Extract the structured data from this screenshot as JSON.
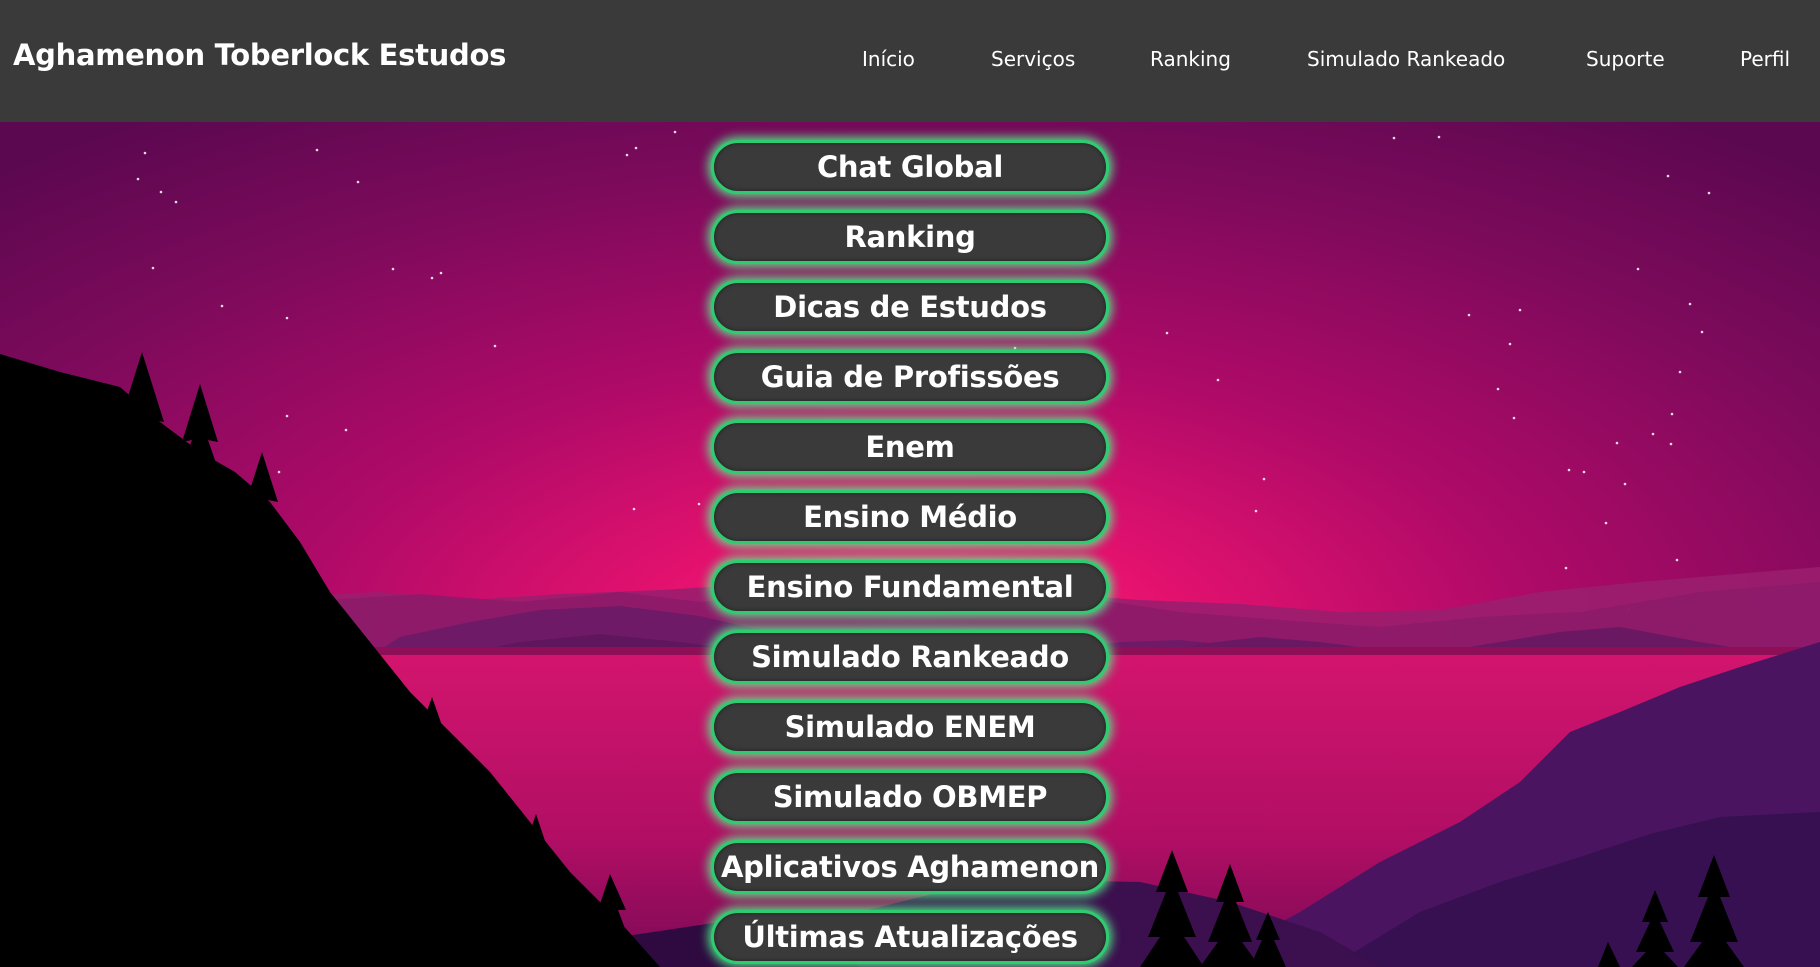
{
  "header": {
    "brand": "Aghamenon Toberlock Estudos",
    "nav": [
      "Início",
      "Serviços",
      "Ranking",
      "Simulado Rankeado",
      "Suporte",
      "Perfil"
    ]
  },
  "menu": {
    "items": [
      "Chat Global",
      "Ranking",
      "Dicas de Estudos",
      "Guia de Profissões",
      "Enem",
      "Ensino Médio",
      "Ensino Fundamental",
      "Simulado Rankeado",
      "Simulado ENEM",
      "Simulado OBMEP",
      "Aplicativos Aghamenon",
      "Últimas Atualizações"
    ]
  },
  "colors": {
    "topbar": "#3a3a3a",
    "button_bg": "#3a3a3a",
    "button_glow": "#2ecc71",
    "sky_top": "#6e0a5a",
    "sky_center": "#e0106e"
  }
}
